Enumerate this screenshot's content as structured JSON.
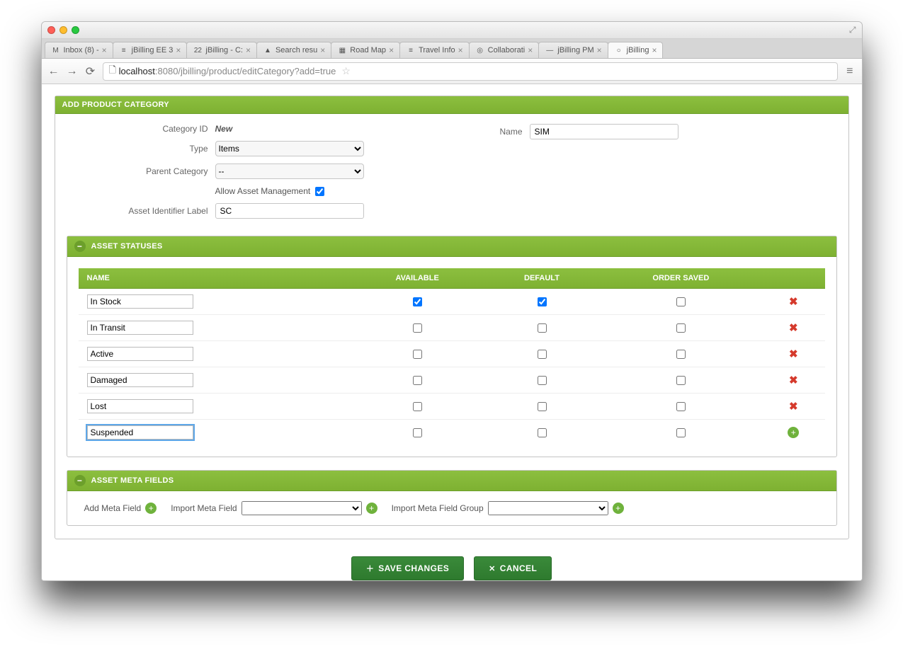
{
  "browser": {
    "url_host": "localhost",
    "url_path": ":8080/jbilling/product/editCategory?add=true",
    "tabs": [
      {
        "label": "Inbox (8) - ",
        "favicon": "M"
      },
      {
        "label": "jBilling EE 3",
        "favicon": "≡"
      },
      {
        "label": "jBilling - C:",
        "favicon": "22"
      },
      {
        "label": "Search resu",
        "favicon": "▲"
      },
      {
        "label": "Road Map",
        "favicon": "▦"
      },
      {
        "label": "Travel Info",
        "favicon": "≡"
      },
      {
        "label": "Collaborati",
        "favicon": "◎"
      },
      {
        "label": "jBilling PM",
        "favicon": "—"
      },
      {
        "label": "jBilling",
        "favicon": "○",
        "active": true
      }
    ]
  },
  "panel_main_title": "ADD PRODUCT CATEGORY",
  "form": {
    "category_id_label": "Category ID",
    "category_id_value": "New",
    "name_label": "Name",
    "name_value": "SIM",
    "type_label": "Type",
    "type_value": "Items",
    "parent_label": "Parent Category",
    "parent_value": "--",
    "allow_asset_label": "Allow Asset Management",
    "allow_asset_checked": true,
    "asset_id_label": "Asset Identifier Label",
    "asset_id_value": "SC"
  },
  "statuses": {
    "title": "ASSET STATUSES",
    "headers": {
      "name": "NAME",
      "available": "AVAILABLE",
      "default": "DEFAULT",
      "order_saved": "ORDER SAVED"
    },
    "rows": [
      {
        "name": "In Stock",
        "available": true,
        "default": true,
        "order_saved": false,
        "action": "delete"
      },
      {
        "name": "In Transit",
        "available": false,
        "default": false,
        "order_saved": false,
        "action": "delete"
      },
      {
        "name": "Active",
        "available": false,
        "default": false,
        "order_saved": false,
        "action": "delete"
      },
      {
        "name": "Damaged",
        "available": false,
        "default": false,
        "order_saved": false,
        "action": "delete"
      },
      {
        "name": "Lost",
        "available": false,
        "default": false,
        "order_saved": false,
        "action": "delete"
      },
      {
        "name": "Suspended",
        "available": false,
        "default": false,
        "order_saved": false,
        "action": "add",
        "focused": true
      }
    ]
  },
  "meta": {
    "title": "ASSET META FIELDS",
    "add_label": "Add Meta Field",
    "import_label": "Import Meta Field",
    "import_group_label": "Import Meta Field Group"
  },
  "buttons": {
    "save": "SAVE CHANGES",
    "cancel": "CANCEL"
  }
}
